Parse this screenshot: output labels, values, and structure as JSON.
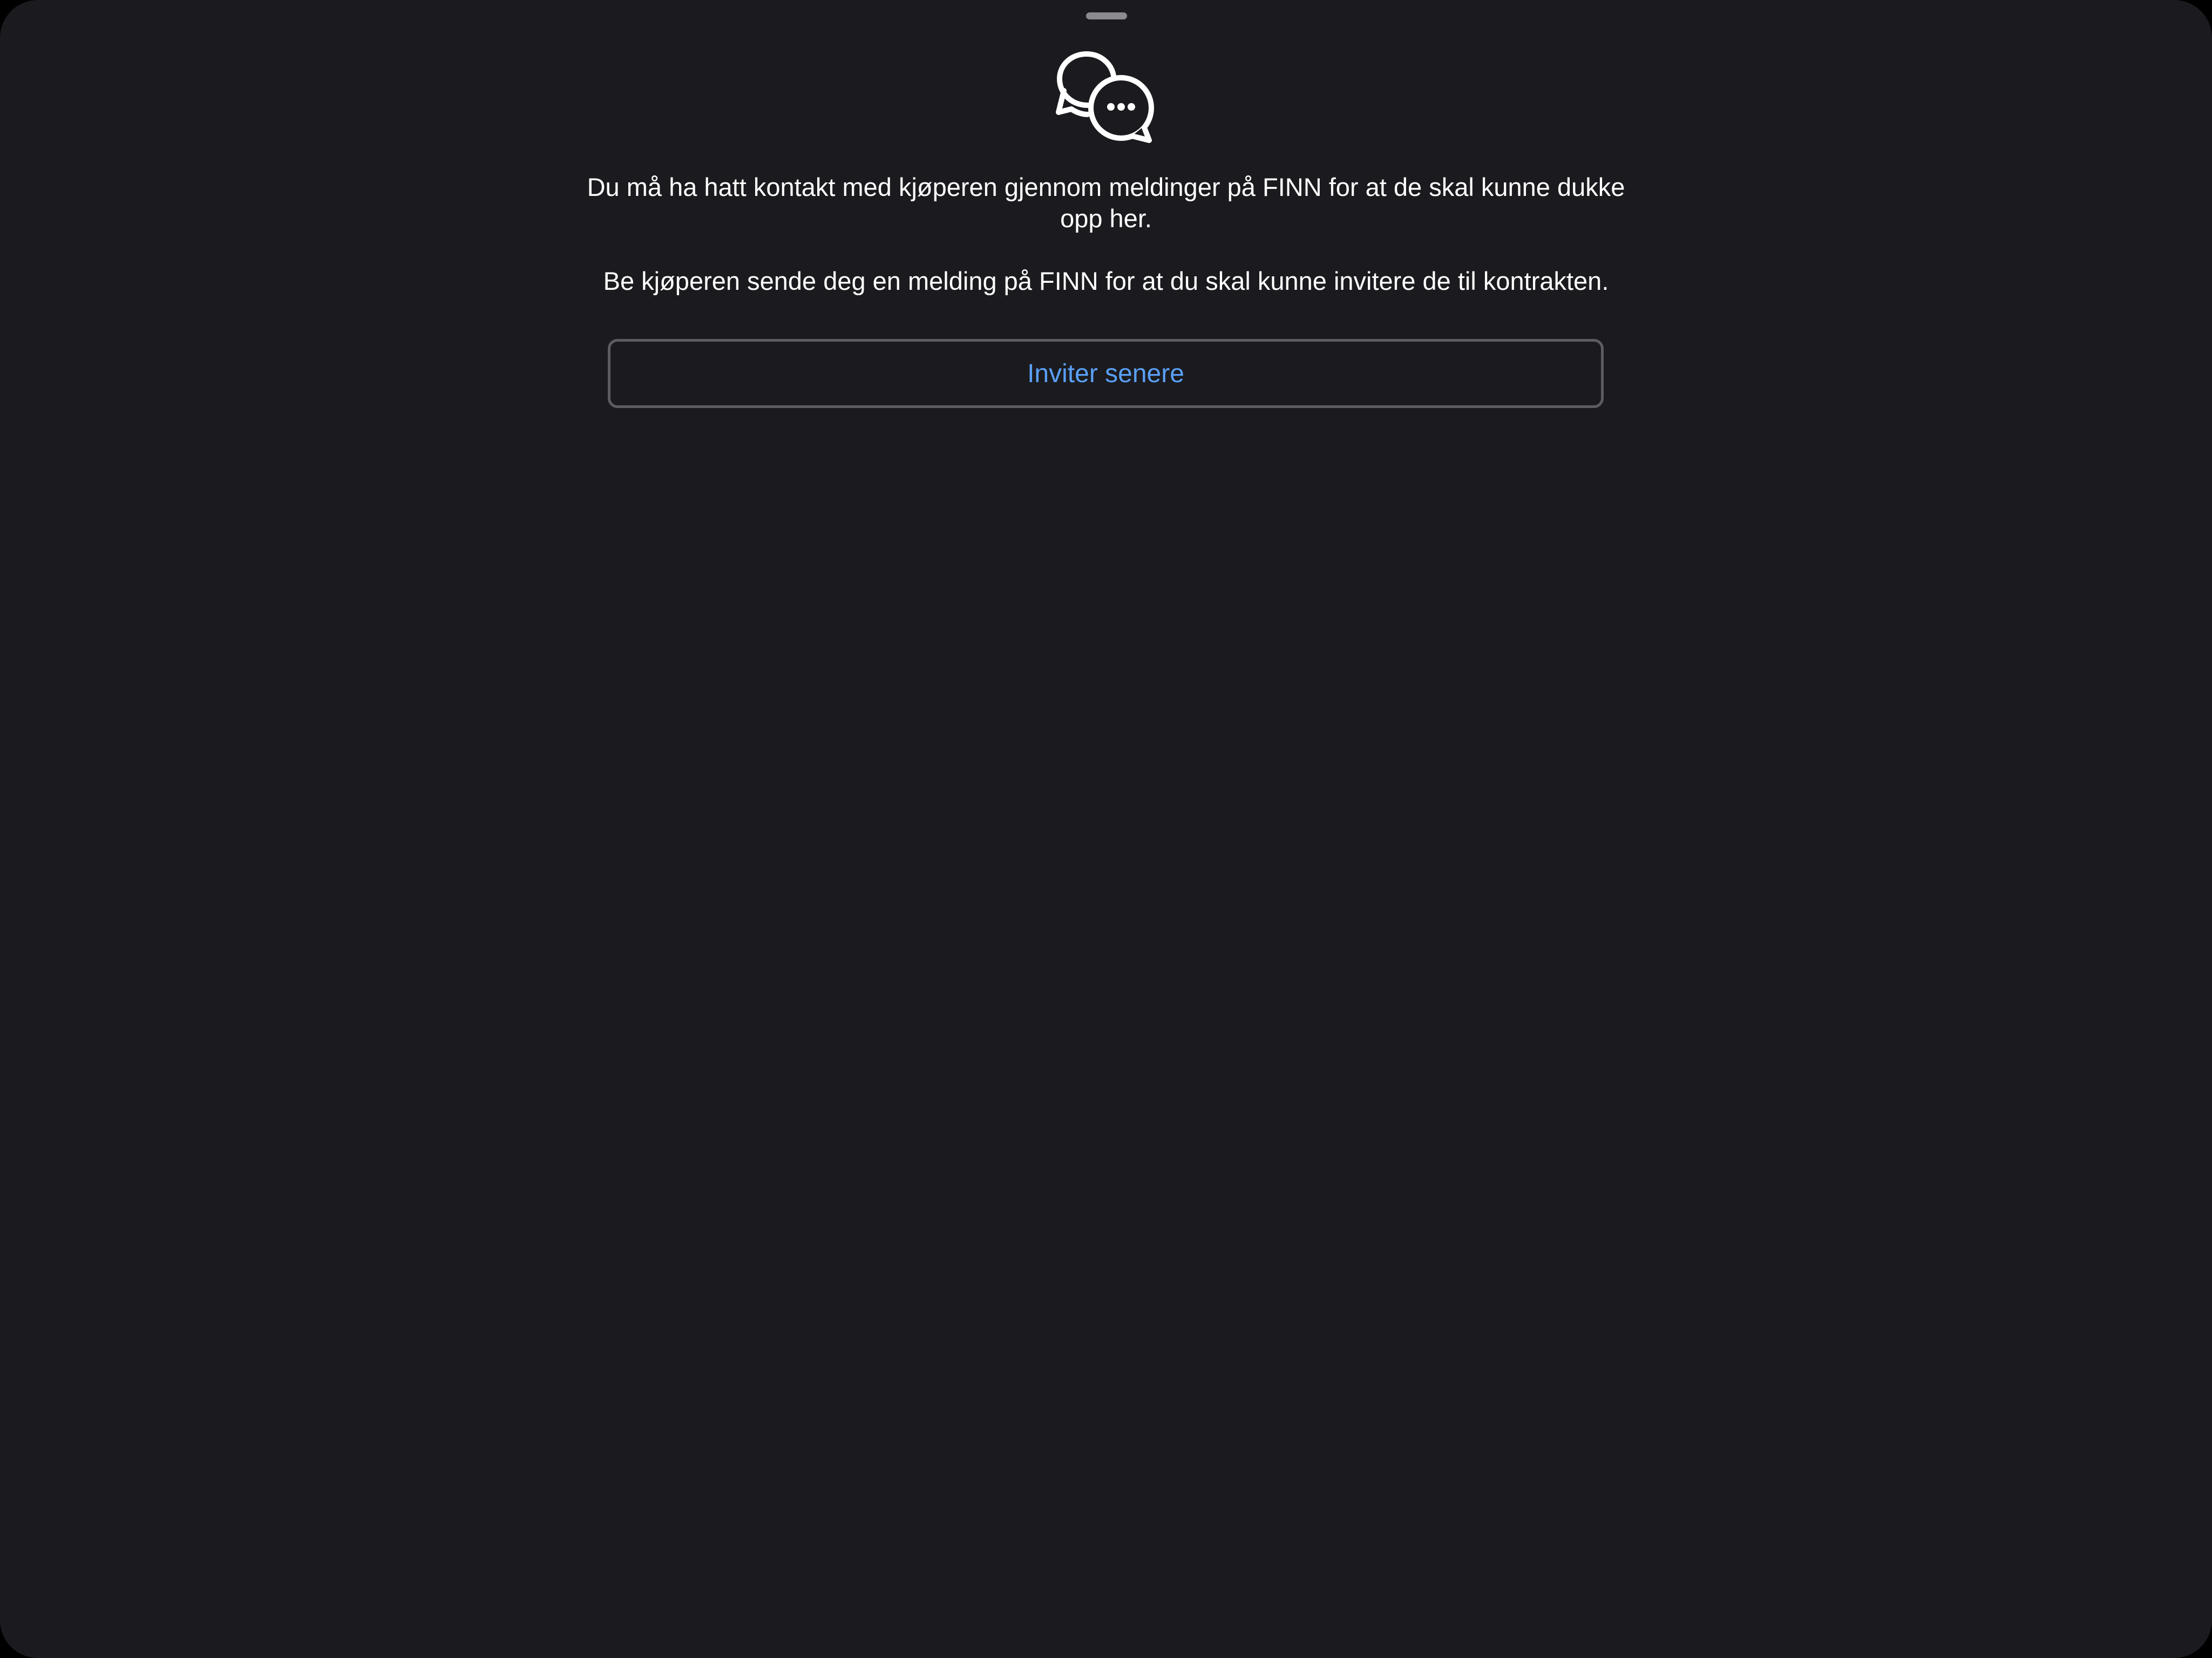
{
  "sheet": {
    "icon": "chat-bubbles-icon",
    "message_line_1": "Du må ha hatt kontakt med kjøperen gjennom meldinger på FINN for at de skal kunne dukke opp her.",
    "message_line_2": "Be kjøperen sende deg en melding på FINN for at du skal kunne invitere de til kontrakten.",
    "invite_later_label": "Inviter senere"
  },
  "colors": {
    "background": "#1b1b1f",
    "text": "#ffffff",
    "accent": "#5aa0f7",
    "button_border": "#5c5c63",
    "grabber": "#8a8a90"
  }
}
